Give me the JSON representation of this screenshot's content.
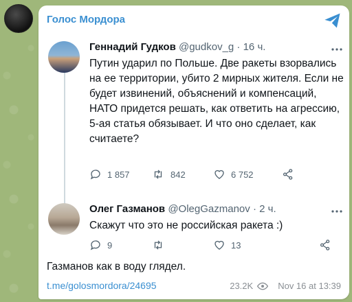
{
  "channel": {
    "name": "Голос Мордора",
    "post_link": "t.me/golosmordora/24695",
    "views": "23.2K",
    "date": "Nov 16 at 13:39",
    "caption": "Газманов как в воду глядел."
  },
  "tweet1": {
    "name": "Геннадий Гудков",
    "handle": "@gudkov_g",
    "separator": "·",
    "time": "16 ч.",
    "text": "Путин ударил по Польше. Две ракеты взорвались на ее территории, убито 2 мирных жителя. Если не будет извинений, объяснений и компенсаций, НАТО придется решать, как ответить на агрессию, 5-ая статья обязывает. И что оно сделает, как считаете?",
    "replies": "1 857",
    "retweets": "842",
    "likes": "6 752"
  },
  "tweet2": {
    "name": "Олег Газманов",
    "handle": "@OlegGazmanov",
    "separator": "·",
    "time": "2 ч.",
    "text": "Скажут что это не российская ракета :)",
    "replies": "9",
    "retweets": "",
    "likes": "13"
  },
  "colors": {
    "accent": "#3a8fd1",
    "background": "#9fb77a",
    "icon_gray": "#536471"
  }
}
